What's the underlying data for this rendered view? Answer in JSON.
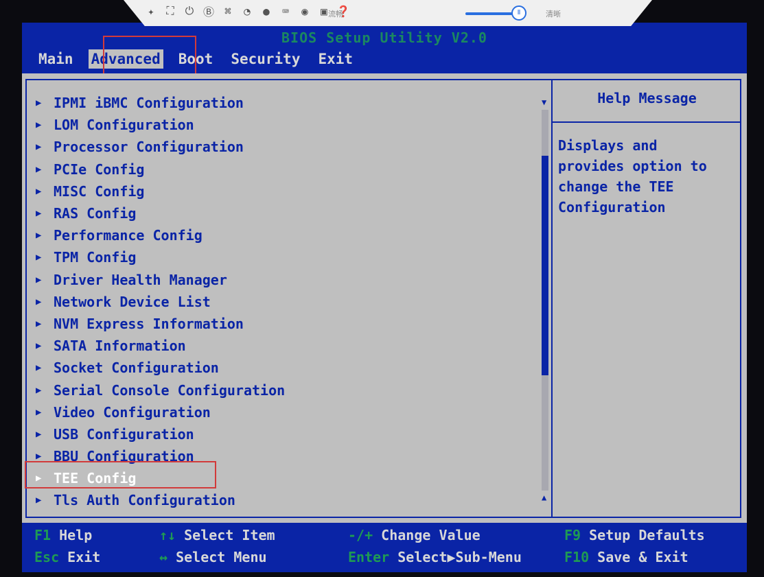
{
  "colors": {
    "bios_blue": "#0a24a6",
    "bios_gray": "#bfbfbf",
    "key_green": "#1f9a54",
    "highlight_red": "#d23a3a"
  },
  "title": "BIOS Setup Utility V2.0",
  "menu": [
    {
      "label": "Main",
      "active": false
    },
    {
      "label": "Advanced",
      "active": true
    },
    {
      "label": "Boot",
      "active": false
    },
    {
      "label": "Security",
      "active": false
    },
    {
      "label": "Exit",
      "active": false
    }
  ],
  "viewer_toolbar": {
    "icons": [
      "pin-icon",
      "fullscreen-icon",
      "power-icon",
      "b-icon",
      "network-icon",
      "mouse-icon",
      "record-icon",
      "keyboard-icon",
      "screenshot-icon",
      "settings-icon",
      "help-icon"
    ],
    "quality_left_label": "流畅",
    "quality_right_label": "清晰",
    "slider_level": 0.85
  },
  "items": [
    "IPMI iBMC Configuration",
    "LOM Configuration",
    "Processor Configuration",
    "PCIe Config",
    "MISC Config",
    "RAS Config",
    "Performance Config",
    "TPM Config",
    "Driver Health Manager",
    "Network Device List",
    "NVM Express Information",
    "SATA Information",
    "Socket Configuration",
    "Serial Console Configuration",
    "Video Configuration",
    "USB Configuration",
    "BBU Configuration",
    "TEE Config",
    "Tls Auth Configuration"
  ],
  "selected_item": "TEE Config",
  "help": {
    "title": "Help Message",
    "text": "Displays and\nprovides option to\nchange the TEE\nConfiguration"
  },
  "footer": {
    "f1_key": "F1",
    "f1_desc": "Help",
    "updown_key": "↑↓",
    "updown_desc": "Select Item",
    "pm_key": "-/+",
    "pm_desc": "Change Value",
    "f9_key": "F9",
    "f9_desc": "Setup Defaults",
    "esc_key": "Esc",
    "esc_desc": "Exit",
    "lr_key": "↔",
    "lr_desc": "Select Menu",
    "enter_key": "Enter",
    "enter_desc": "Select▶Sub-Menu",
    "f10_key": "F10",
    "f10_desc": "Save & Exit"
  }
}
